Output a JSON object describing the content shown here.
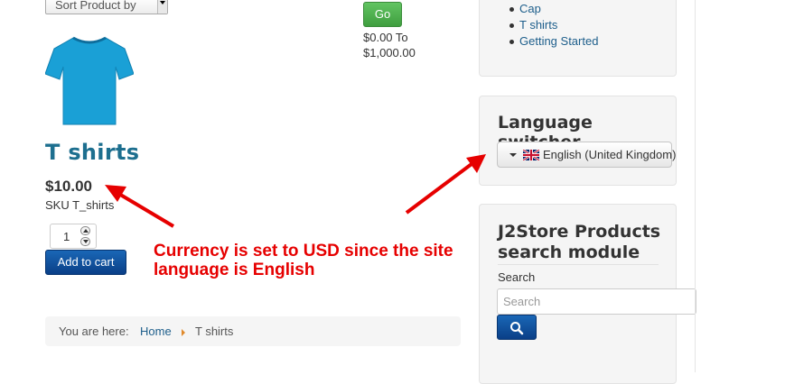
{
  "sort": {
    "label": "Sort Product by"
  },
  "filter": {
    "go_label": "Go",
    "range_line1": "$0.00 To",
    "range_line2": "$1,000.00"
  },
  "product": {
    "title": "T shirts",
    "price": "$10.00",
    "sku": "SKU T_shirts",
    "quantity": "1",
    "add_to_cart_label": "Add to cart",
    "image_icon": "tshirt-image"
  },
  "breadcrumb": {
    "prefix": "You are here:",
    "home": "Home",
    "current": "T shirts"
  },
  "categories": {
    "items": [
      "Cap",
      "T shirts",
      "Getting Started"
    ]
  },
  "language_switcher": {
    "heading": "Language switcher",
    "selected": "English (United Kingdom)",
    "flag_icon": "uk-flag-icon"
  },
  "search_module": {
    "heading_line1": "J2Store Products",
    "heading_line2": "search module",
    "label": "Search",
    "placeholder": "Search",
    "button_icon": "search-icon"
  },
  "annotation": {
    "line1": "Currency is set to USD since the site",
    "line2": "language is English",
    "color": "#e60000"
  },
  "colors": {
    "accent_link": "#1d5e8b",
    "product_title": "#1d6f8f",
    "primary_button": "#0a3f87",
    "go_button": "#4cae4c"
  }
}
